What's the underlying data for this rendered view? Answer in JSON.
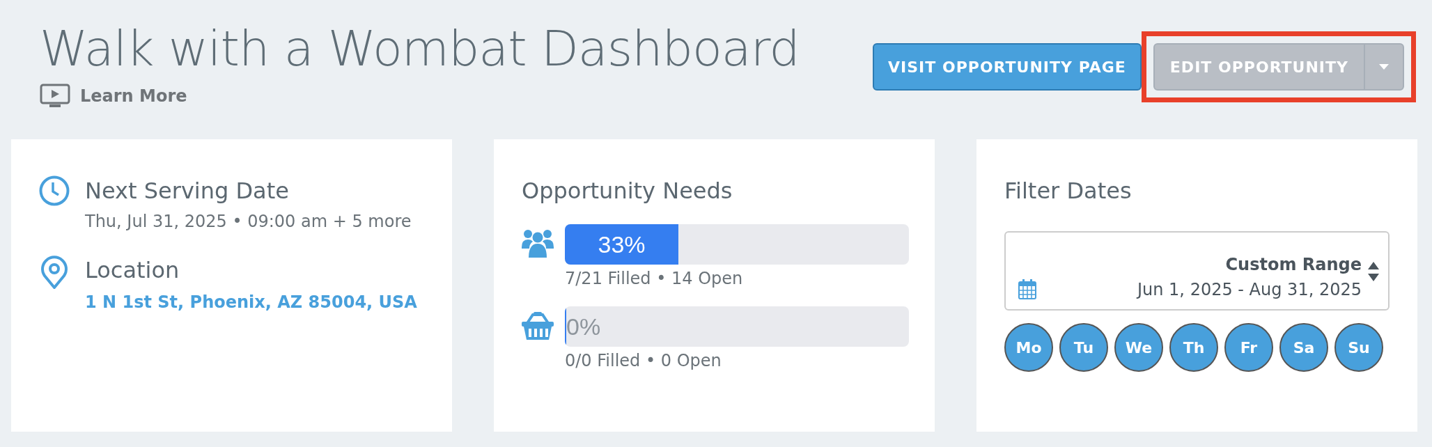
{
  "header": {
    "title": "Walk with a Wombat Dashboard",
    "learn_more": "Learn More"
  },
  "actions": {
    "visit_button": "VISIT OPPORTUNITY PAGE",
    "edit_button": "EDIT OPPORTUNITY",
    "highlighted": true
  },
  "serving": {
    "title": "Next Serving Date",
    "date": "Thu, Jul 31, 2025 • 09:00 am + 5 more",
    "location_title": "Location",
    "address": "1 N 1st St, Phoenix, AZ 85004, USA"
  },
  "needs": {
    "title": "Opportunity Needs",
    "items": [
      {
        "kind": "people",
        "level": 0.33,
        "percent": "33%",
        "summary": "7/21 Filled • 14 Open"
      },
      {
        "kind": "basket",
        "level": 0,
        "percent": "0%",
        "summary": "0/0 Filled • 0 Open"
      }
    ]
  },
  "filter": {
    "title": "Filter Dates",
    "range_label": "Custom Range",
    "range": "Jun 1, 2025 - Aug 31, 2025",
    "days": [
      {
        "label": "Mo",
        "selected": true
      },
      {
        "label": "Tu",
        "selected": true
      },
      {
        "label": "We",
        "selected": true
      },
      {
        "label": "Th",
        "selected": true
      },
      {
        "label": "Fr",
        "selected": true
      },
      {
        "label": "Sa",
        "selected": true
      },
      {
        "label": "Su",
        "selected": true
      }
    ]
  }
}
